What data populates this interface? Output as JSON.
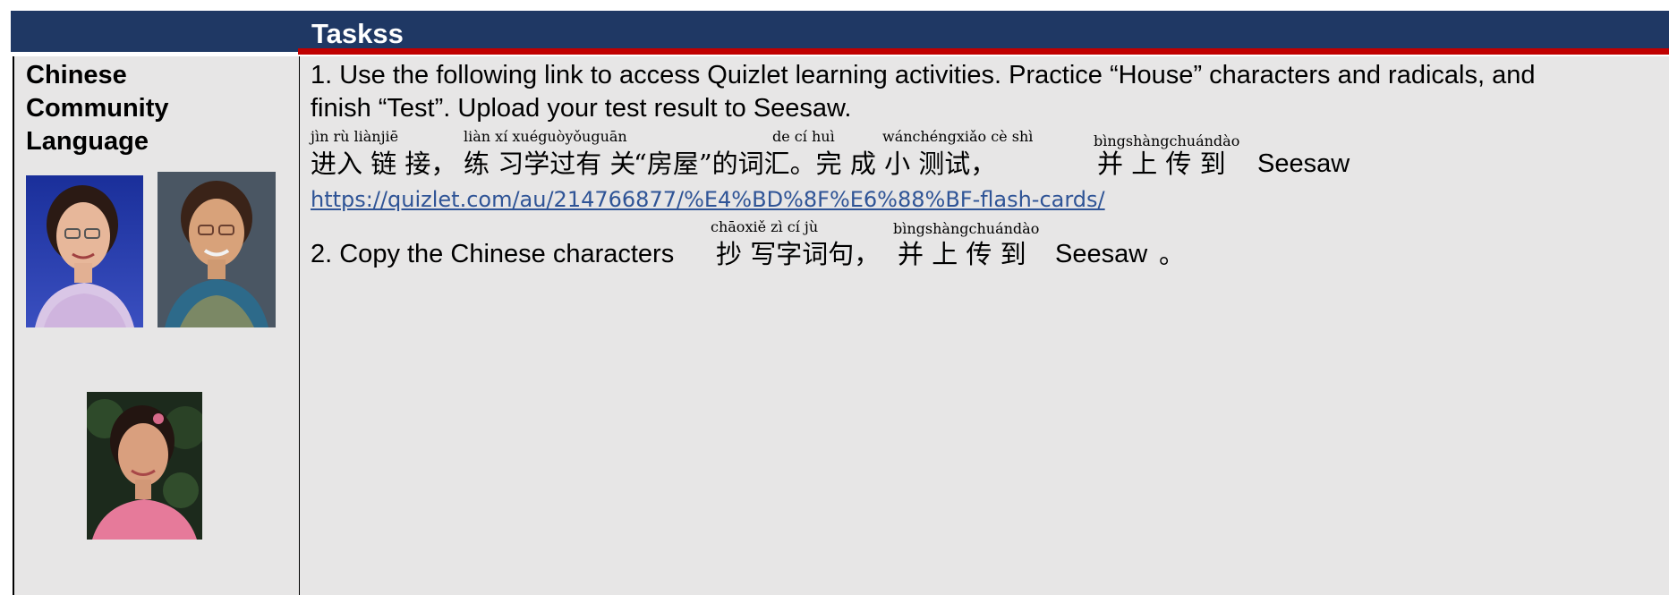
{
  "header": {
    "title": "Taskss"
  },
  "subject": {
    "line1": "Chinese",
    "line2": "Community",
    "line3": "Language"
  },
  "photos": [
    {
      "name": "teacher-photo-1"
    },
    {
      "name": "teacher-photo-2"
    },
    {
      "name": "teacher-photo-3"
    }
  ],
  "tasks": {
    "task1_line1": "1. Use the following link to access Quizlet learning activities. Practice “House” characters and radicals, and",
    "task1_line2": "finish “Test”. Upload your test result to Seesaw.",
    "task1_pinyin": {
      "p1": "jìn rù liànjiē",
      "p2": "liàn xí xuéguòyǒuguān",
      "p3": "de cí huì",
      "p4": "wánchéngxiǎo cè shì",
      "p5": "bìngshàngchuándào"
    },
    "task1_chinese": {
      "c1": "进入 链 接，",
      "c2": "练 习学过有 关",
      "c3": "“房屋”的词汇。完 成 小 测试，",
      "c4": "并 上 传 到",
      "seesaw": "Seesaw"
    },
    "link": "https://quizlet.com/au/214766877/%E4%BD%8F%E6%88%BF-flash-cards/",
    "task2_pinyin": {
      "p1": "chāoxiě zì cí jù",
      "p2": "bìngshàngchuándào"
    },
    "task2_prefix": "2. Copy the Chinese characters",
    "task2_chinese": {
      "c1": "抄 写字词句，",
      "c2": "并 上 传 到",
      "seesaw": "Seesaw",
      "end": "。"
    }
  },
  "colors": {
    "header": "#1f3864",
    "accent_red": "#c00000",
    "cell_bg": "#e7e6e6",
    "link": "#2f5496"
  }
}
